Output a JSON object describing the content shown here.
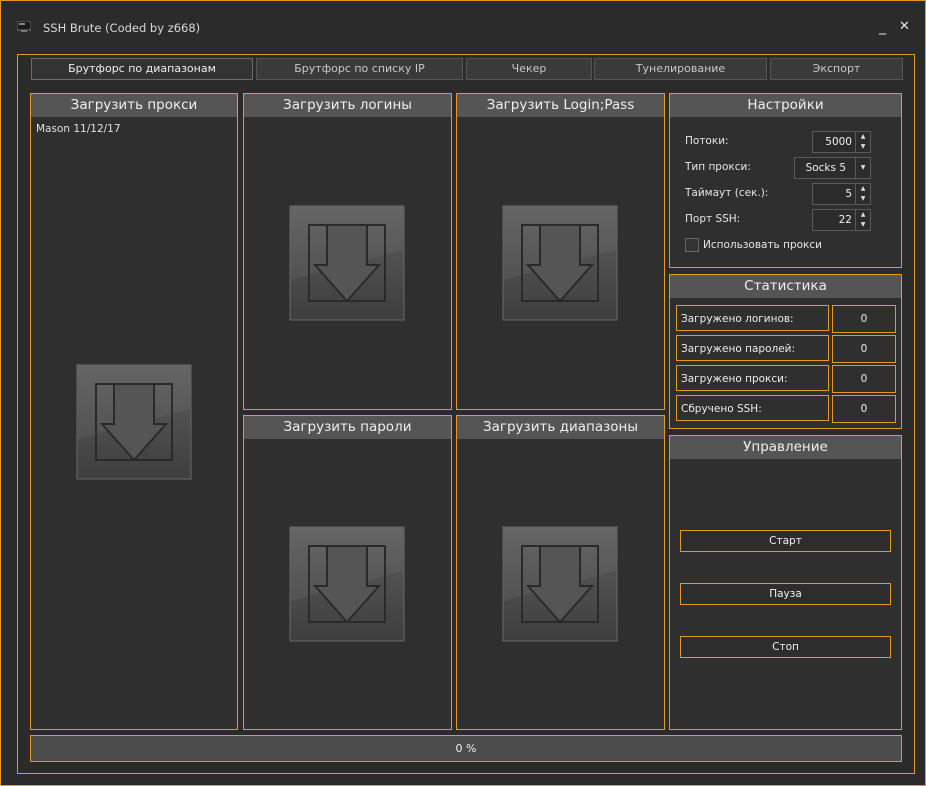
{
  "window": {
    "title": "SSH Brute (Coded by z668)",
    "minimize_label": "_",
    "close_label": "✕"
  },
  "tabs": [
    {
      "label": "Брутфорс по диапазонам",
      "active": true
    },
    {
      "label": "Брутфорс по списку IP",
      "active": false
    },
    {
      "label": "Чекер",
      "active": false
    },
    {
      "label": "Тунелирование",
      "active": false
    },
    {
      "label": "Экспорт",
      "active": false
    }
  ],
  "proxies": {
    "title": "Загрузить прокси",
    "content": "Mason 11/12/17",
    "icon": "download-icon"
  },
  "logins": {
    "title": "Загрузить логины",
    "icon": "download-icon"
  },
  "loginpass": {
    "title": "Загрузить Login;Pass",
    "icon": "download-icon"
  },
  "passwords": {
    "title": "Загрузить пароли",
    "icon": "download-icon"
  },
  "ranges": {
    "title": "Загрузить диапазоны",
    "icon": "download-icon"
  },
  "settings": {
    "title": "Настройки",
    "threads_label": "Потоки:",
    "threads_value": "5000",
    "proxy_type_label": "Тип прокси:",
    "proxy_type_value": "Socks 5",
    "timeout_label": "Таймаут (сек.):",
    "timeout_value": "5",
    "port_label": "Порт SSH:",
    "port_value": "22",
    "use_proxy_label": "Использовать прокси",
    "use_proxy_checked": false
  },
  "stats": {
    "title": "Статистика",
    "rows": [
      {
        "label": "Загружено логинов:",
        "value": "0"
      },
      {
        "label": "Загружено паролей:",
        "value": "0"
      },
      {
        "label": "Загружено прокси:",
        "value": "0"
      },
      {
        "label": "Сбручено SSH:",
        "value": "0"
      }
    ]
  },
  "control": {
    "title": "Управление",
    "start": "Старт",
    "pause": "Пауза",
    "stop": "Стоп"
  },
  "progress": {
    "percent": 0,
    "text": "0 %"
  },
  "colors": {
    "accent": "#e39a1e",
    "header": "#555555",
    "background": "#2b2b2b"
  }
}
